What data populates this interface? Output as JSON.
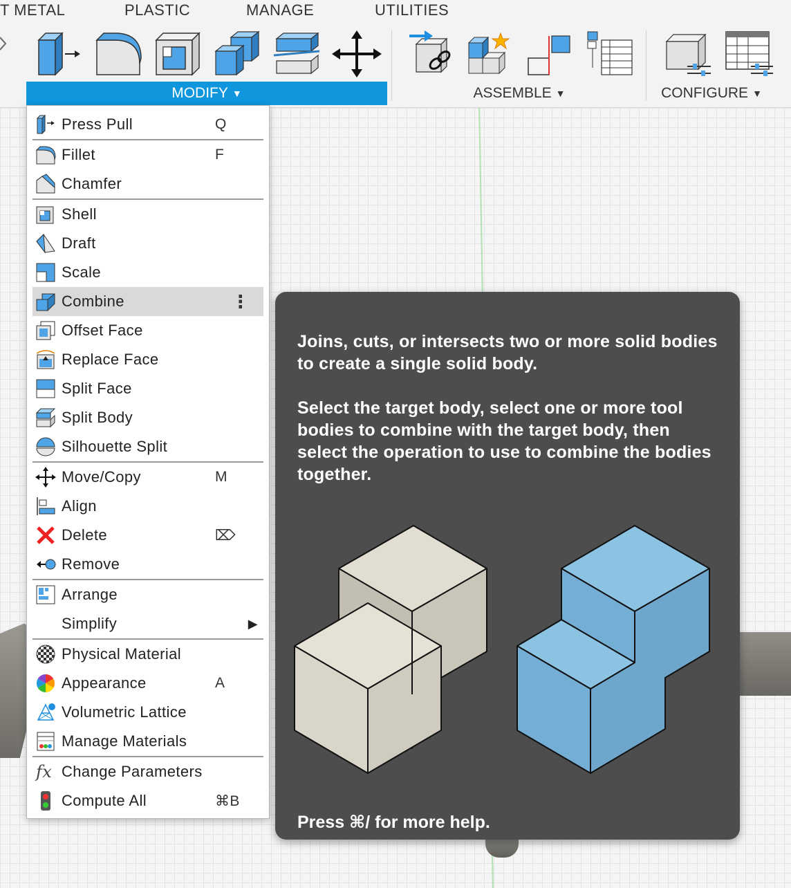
{
  "tabs": [
    "T METAL",
    "PLASTIC",
    "MANAGE",
    "UTILITIES"
  ],
  "groups": {
    "modify": "MODIFY",
    "assemble": "ASSEMBLE",
    "configure": "CONFIGURE",
    "caret": "▼"
  },
  "menu": {
    "items": [
      {
        "label": "Press Pull",
        "shortcut": "Q",
        "icon": "press-pull-icon"
      },
      {
        "label": "Fillet",
        "shortcut": "F",
        "icon": "fillet-icon"
      },
      {
        "label": "Chamfer",
        "shortcut": "",
        "icon": "chamfer-icon"
      },
      {
        "label": "Shell",
        "shortcut": "",
        "icon": "shell-icon"
      },
      {
        "label": "Draft",
        "shortcut": "",
        "icon": "draft-icon"
      },
      {
        "label": "Scale",
        "shortcut": "",
        "icon": "scale-icon"
      },
      {
        "label": "Combine",
        "shortcut": "",
        "icon": "combine-icon"
      },
      {
        "label": "Offset Face",
        "shortcut": "",
        "icon": "offset-face-icon"
      },
      {
        "label": "Replace Face",
        "shortcut": "",
        "icon": "replace-face-icon"
      },
      {
        "label": "Split Face",
        "shortcut": "",
        "icon": "split-face-icon"
      },
      {
        "label": "Split Body",
        "shortcut": "",
        "icon": "split-body-icon"
      },
      {
        "label": "Silhouette Split",
        "shortcut": "",
        "icon": "silhouette-split-icon"
      },
      {
        "label": "Move/Copy",
        "shortcut": "M",
        "icon": "move-copy-icon"
      },
      {
        "label": "Align",
        "shortcut": "",
        "icon": "align-icon"
      },
      {
        "label": "Delete",
        "shortcut": "⌦",
        "icon": "delete-icon"
      },
      {
        "label": "Remove",
        "shortcut": "",
        "icon": "remove-icon"
      },
      {
        "label": "Arrange",
        "shortcut": "",
        "icon": "arrange-icon"
      },
      {
        "label": "Simplify",
        "shortcut": "",
        "icon": "simplify-icon"
      },
      {
        "label": "Physical Material",
        "shortcut": "",
        "icon": "physical-material-icon"
      },
      {
        "label": "Appearance",
        "shortcut": "A",
        "icon": "appearance-icon"
      },
      {
        "label": "Volumetric Lattice",
        "shortcut": "",
        "icon": "volumetric-lattice-icon"
      },
      {
        "label": "Manage Materials",
        "shortcut": "",
        "icon": "manage-materials-icon"
      },
      {
        "label": "Change Parameters",
        "shortcut": "",
        "icon": "change-parameters-icon"
      },
      {
        "label": "Compute All",
        "shortcut": "⌘B",
        "icon": "compute-all-icon"
      }
    ],
    "more_glyph": "⋮",
    "submenu_glyph": "▶"
  },
  "tooltip": {
    "paragraph1": "Joins, cuts, or intersects two or more solid bodies to create a single solid body.",
    "paragraph2": "Select the target body, select one or more tool bodies to combine with the target body, then select the operation to use to combine the bodies together.",
    "footer": "Press ⌘/ for more help."
  },
  "colors": {
    "accent": "#0f96dc",
    "icon_blue": "#4ea4e6",
    "tooltip_bg": "#4d4d4d",
    "cube_beige": "#dcd8cc",
    "cube_blue": "#84bfe0"
  }
}
